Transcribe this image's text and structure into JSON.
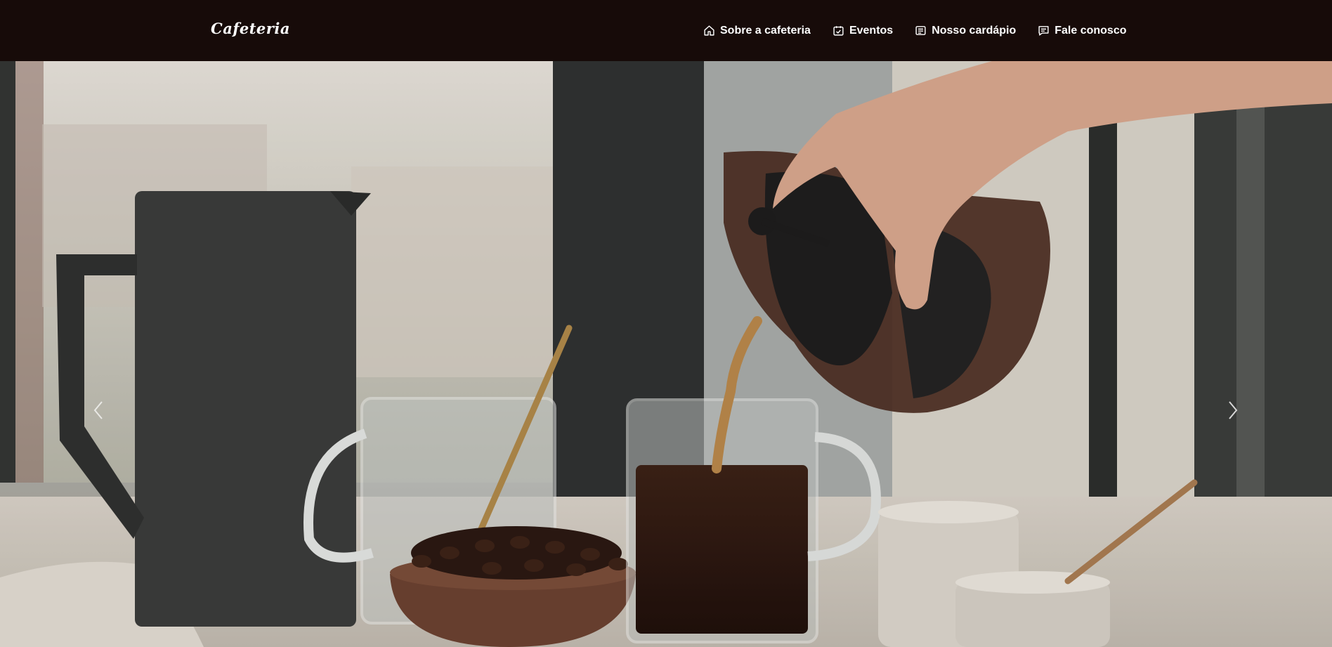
{
  "navbar": {
    "brand": "Cafeteria",
    "items": [
      {
        "label": "Sobre a cafeteria",
        "icon": "home-icon"
      },
      {
        "label": "Eventos",
        "icon": "calendar-check-icon"
      },
      {
        "label": "Nosso cardápio",
        "icon": "menu-card-icon"
      },
      {
        "label": "Fale conosco",
        "icon": "chat-icon"
      }
    ]
  },
  "hero": {
    "image": "coffee-pouring-photo",
    "prev_icon": "chevron-left-icon",
    "next_icon": "chevron-right-icon"
  },
  "colors": {
    "navbar_bg": "#170b09",
    "nav_text": "#ffffff"
  }
}
